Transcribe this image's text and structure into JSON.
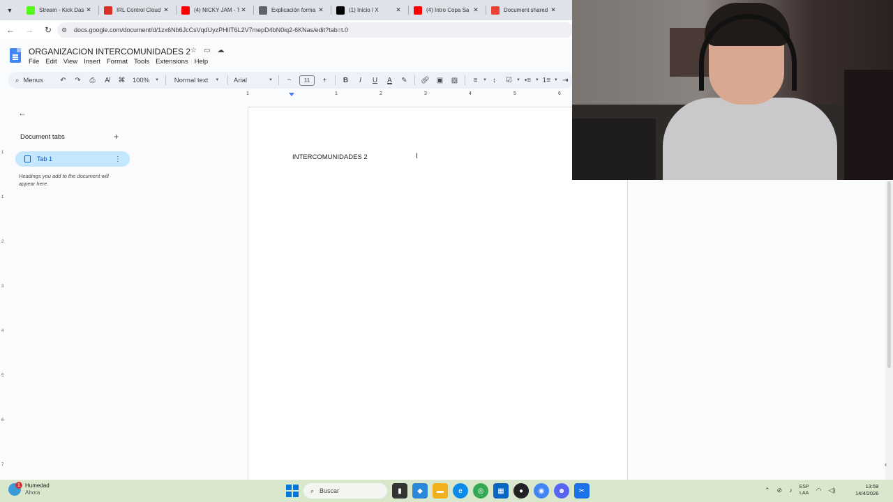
{
  "browser": {
    "tabs": [
      {
        "title": "Stream - Kick Das",
        "icon": "kick-icon",
        "color": "#53fc18"
      },
      {
        "title": "IRL Control Cloud",
        "icon": "irl-icon",
        "color": "#d93025"
      },
      {
        "title": "(4) NICKY JAM - T",
        "icon": "youtube-icon",
        "color": "#ff0000"
      },
      {
        "title": "Explicación forma",
        "icon": "globe-icon",
        "color": "#5f6368"
      },
      {
        "title": "(1) Inicio / X",
        "icon": "x-icon",
        "color": "#000000"
      },
      {
        "title": "(4) Intro Copa Sa",
        "icon": "youtube-icon",
        "color": "#ff0000"
      },
      {
        "title": "Document shared",
        "icon": "gmail-icon",
        "color": "#ea4335"
      }
    ],
    "url": "docs.google.com/document/d/1zx6Nb6JcCsVqdUyzPHlIT6L2V7mepD4bN0iq2-6KNas/edit?tab=t.0"
  },
  "doc": {
    "title": "ORGANIZACION INTERCOMUNIDADES 2",
    "menu": [
      "File",
      "Edit",
      "View",
      "Insert",
      "Format",
      "Tools",
      "Extensions",
      "Help"
    ],
    "content_text": "INTERCOMUNIDADES 2"
  },
  "toolbar": {
    "search_label": "Menus",
    "zoom": "100%",
    "style": "Normal text",
    "font": "Arial",
    "font_size": "11"
  },
  "ruler": {
    "h_ticks": [
      "1",
      "1",
      "2",
      "3",
      "4",
      "5",
      "6"
    ],
    "v_ticks": [
      "1",
      "1",
      "2",
      "3",
      "4",
      "5",
      "6",
      "7"
    ]
  },
  "sidebar": {
    "heading": "Document tabs",
    "tab_label": "Tab 1",
    "hint": "Headings you add to the document will appear here."
  },
  "taskbar": {
    "weather_label": "Humedad",
    "weather_sub": "Ahora",
    "weather_badge": "1",
    "search_placeholder": "Buscar",
    "lang_line1": "ESP",
    "lang_line2": "LAA",
    "time": "13:59",
    "date": "14/4/2026"
  },
  "colors": {
    "accent": "#0b57d0",
    "tab_selected_bg": "#c2e7ff",
    "taskbar_bg": "#d9e7cc"
  }
}
